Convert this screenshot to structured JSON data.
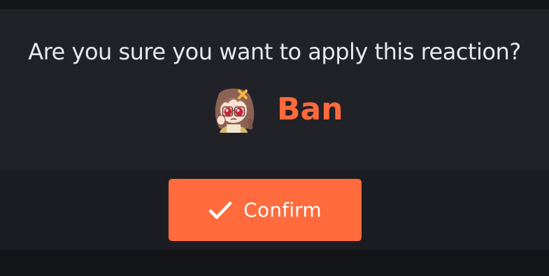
{
  "dialog": {
    "question": "Are you sure you want to apply this reaction?",
    "reaction": {
      "name": "Ban",
      "avatar_icon": "anime-girl-avatar-icon"
    },
    "confirm_button": {
      "label": "Confirm",
      "icon": "check-icon"
    }
  },
  "colors": {
    "page_background": "#141519",
    "panel_background": "#212227",
    "footer_background": "#1c1d22",
    "question_text": "#e4eaf2",
    "accent": "#ff6a3d",
    "button_text": "#ffffff"
  }
}
